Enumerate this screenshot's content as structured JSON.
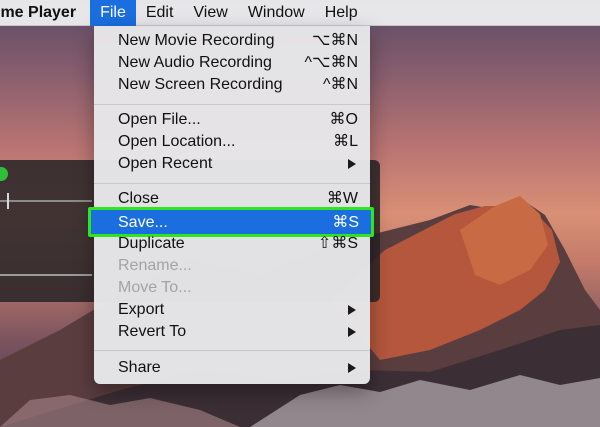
{
  "menubar": {
    "app_name": "ime Player",
    "menus": [
      "File",
      "Edit",
      "View",
      "Window",
      "Help"
    ],
    "active_menu": "File"
  },
  "file_menu": {
    "items": [
      {
        "label": "New Movie Recording",
        "shortcut": "⌥⌘N"
      },
      {
        "label": "New Audio Recording",
        "shortcut": "^⌥⌘N"
      },
      {
        "label": "New Screen Recording",
        "shortcut": "^⌘N"
      },
      {
        "label": "Open File...",
        "shortcut": "⌘O"
      },
      {
        "label": "Open Location...",
        "shortcut": "⌘L"
      },
      {
        "label": "Open Recent",
        "submenu": true
      },
      {
        "label": "Close",
        "shortcut": "⌘W"
      },
      {
        "label": "Save...",
        "shortcut": "⌘S",
        "highlighted": true
      },
      {
        "label": "Duplicate",
        "shortcut": "⇧⌘S"
      },
      {
        "label": "Rename...",
        "disabled": true
      },
      {
        "label": "Move To...",
        "disabled": true
      },
      {
        "label": "Export",
        "submenu": true
      },
      {
        "label": "Revert To",
        "submenu": true
      },
      {
        "label": "Share",
        "submenu": true
      }
    ]
  },
  "colors": {
    "highlight": "#1a6ee0",
    "highlight_outline": "#2ee51f",
    "disabled_text": "#a3a3a6"
  }
}
